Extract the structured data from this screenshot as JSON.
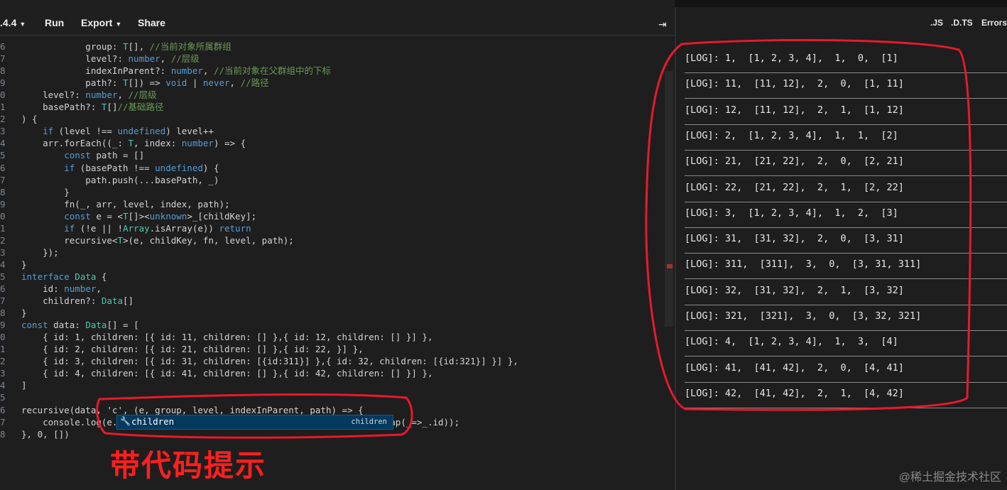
{
  "toolbar": {
    "version": ".4.4",
    "run": "Run",
    "export": "Export",
    "share": "Share",
    "collapse_icon": "collapse-right-icon"
  },
  "output_tabs": {
    "js": ".JS",
    "dts": ".D.TS",
    "errors": "Errors"
  },
  "editor": {
    "lines": [
      {
        "n": "6",
        "segs": [
          [
            "pl",
            "            group: "
          ],
          [
            "ty",
            "T"
          ],
          [
            "pl",
            "[], "
          ],
          [
            "cm",
            "//当前对象所属群组"
          ]
        ]
      },
      {
        "n": "7",
        "segs": [
          [
            "pl",
            "            level?: "
          ],
          [
            "kw",
            "number"
          ],
          [
            "pl",
            ", "
          ],
          [
            "cm",
            "//层级"
          ]
        ]
      },
      {
        "n": "8",
        "segs": [
          [
            "pl",
            "            indexInParent?: "
          ],
          [
            "kw",
            "number"
          ],
          [
            "pl",
            ", "
          ],
          [
            "cm",
            "//当前对象在父群组中的下标"
          ]
        ]
      },
      {
        "n": "9",
        "segs": [
          [
            "pl",
            "            path?: "
          ],
          [
            "ty",
            "T"
          ],
          [
            "pl",
            "[]) => "
          ],
          [
            "kw",
            "void"
          ],
          [
            "pl",
            " | "
          ],
          [
            "kw",
            "never"
          ],
          [
            "pl",
            ", "
          ],
          [
            "cm",
            "//路径"
          ]
        ]
      },
      {
        "n": "0",
        "segs": [
          [
            "pl",
            "    level?: "
          ],
          [
            "kw",
            "number"
          ],
          [
            "pl",
            ", "
          ],
          [
            "cm",
            "//层级"
          ]
        ]
      },
      {
        "n": "1",
        "segs": [
          [
            "pl",
            "    basePath?: "
          ],
          [
            "ty",
            "T"
          ],
          [
            "pl",
            "[]"
          ],
          [
            "cm",
            "//基础路径"
          ]
        ]
      },
      {
        "n": "2",
        "segs": [
          [
            "pl",
            ") {"
          ]
        ]
      },
      {
        "n": "3",
        "segs": [
          [
            "kw",
            "    if"
          ],
          [
            "pl",
            " (level !== "
          ],
          [
            "kw",
            "undefined"
          ],
          [
            "pl",
            ") level++"
          ]
        ]
      },
      {
        "n": "4",
        "segs": [
          [
            "pl",
            "    arr.forEach((_: "
          ],
          [
            "ty",
            "T"
          ],
          [
            "pl",
            ", index: "
          ],
          [
            "kw",
            "number"
          ],
          [
            "pl",
            ") => {"
          ]
        ]
      },
      {
        "n": "5",
        "segs": [
          [
            "kw",
            "        const"
          ],
          [
            "pl",
            " path = []"
          ]
        ]
      },
      {
        "n": "6",
        "segs": [
          [
            "kw",
            "        if"
          ],
          [
            "pl",
            " (basePath !== "
          ],
          [
            "kw",
            "undefined"
          ],
          [
            "pl",
            ") {"
          ]
        ]
      },
      {
        "n": "7",
        "segs": [
          [
            "pl",
            "            path.push(...basePath, _)"
          ]
        ]
      },
      {
        "n": "8",
        "segs": [
          [
            "pl",
            "        }"
          ]
        ]
      },
      {
        "n": "9",
        "segs": [
          [
            "pl",
            "        fn(_, arr, level, index, path);"
          ]
        ]
      },
      {
        "n": "0",
        "segs": [
          [
            "kw",
            "        const"
          ],
          [
            "pl",
            " e = <"
          ],
          [
            "ty",
            "T"
          ],
          [
            "pl",
            "[]><"
          ],
          [
            "kw",
            "unknown"
          ],
          [
            "pl",
            ">_[childKey];"
          ]
        ]
      },
      {
        "n": "1",
        "segs": [
          [
            "kw",
            "        if"
          ],
          [
            "pl",
            " (!e || !"
          ],
          [
            "ty",
            "Array"
          ],
          [
            "pl",
            ".isArray(e)) "
          ],
          [
            "kw",
            "return"
          ]
        ]
      },
      {
        "n": "2",
        "segs": [
          [
            "pl",
            "        recursive<"
          ],
          [
            "ty",
            "T"
          ],
          [
            "pl",
            ">(e, childKey, fn, level, path);"
          ]
        ]
      },
      {
        "n": "3",
        "segs": [
          [
            "pl",
            "    });"
          ]
        ]
      },
      {
        "n": "4",
        "segs": [
          [
            "pl",
            "}"
          ]
        ]
      },
      {
        "n": "5",
        "segs": [
          [
            "kw",
            "interface"
          ],
          [
            "pl",
            " "
          ],
          [
            "ty",
            "Data"
          ],
          [
            "pl",
            " {"
          ]
        ]
      },
      {
        "n": "6",
        "segs": [
          [
            "pl",
            "    id: "
          ],
          [
            "kw",
            "number"
          ],
          [
            "pl",
            ","
          ]
        ]
      },
      {
        "n": "7",
        "segs": [
          [
            "pl",
            "    children?: "
          ],
          [
            "ty",
            "Data"
          ],
          [
            "pl",
            "[]"
          ]
        ]
      },
      {
        "n": "8",
        "segs": [
          [
            "pl",
            "}"
          ]
        ]
      },
      {
        "n": "9",
        "segs": [
          [
            "kw",
            "const"
          ],
          [
            "pl",
            " data: "
          ],
          [
            "ty",
            "Data"
          ],
          [
            "pl",
            "[] = ["
          ]
        ]
      },
      {
        "n": "0",
        "segs": [
          [
            "pl",
            "    { id: 1, children: [{ id: 11, children: [] },{ id: 12, children: [] }] },"
          ]
        ]
      },
      {
        "n": "1",
        "segs": [
          [
            "pl",
            "    { id: 2, children: [{ id: 21, children: [] },{ id: 22, }] },"
          ]
        ]
      },
      {
        "n": "2",
        "segs": [
          [
            "pl",
            "    { id: 3, children: [{ id: 31, children: [{id:311}] },{ id: 32, children: [{id:321}] }] },"
          ]
        ]
      },
      {
        "n": "3",
        "segs": [
          [
            "pl",
            "    { id: 4, children: [{ id: 41, children: [] },{ id: 42, children: [] }] },"
          ]
        ]
      },
      {
        "n": "4",
        "segs": [
          [
            "pl",
            "]"
          ]
        ]
      },
      {
        "n": "5",
        "segs": [
          [
            "pl",
            ""
          ]
        ]
      },
      {
        "n": "6",
        "segs": [
          [
            "pl",
            "recursive(data, 'c', (e, group, level, indexInParent, path) => {"
          ]
        ]
      },
      {
        "n": "7",
        "segs": [
          [
            "pl",
            "    console.log(e.                                                  map(_=>_.id));"
          ]
        ]
      },
      {
        "n": "8",
        "segs": [
          [
            "pl",
            "}, 0, [])"
          ]
        ]
      }
    ]
  },
  "autocomplete": {
    "icon": "wrench-icon",
    "label": "children",
    "type_hint": "children"
  },
  "log_rows": [
    "[LOG]: 1,  [1, 2, 3, 4],  1,  0,  [1]",
    "[LOG]: 11,  [11, 12],  2,  0,  [1, 11]",
    "[LOG]: 12,  [11, 12],  2,  1,  [1, 12]",
    "[LOG]: 2,  [1, 2, 3, 4],  1,  1,  [2]",
    "[LOG]: 21,  [21, 22],  2,  0,  [2, 21]",
    "[LOG]: 22,  [21, 22],  2,  1,  [2, 22]",
    "[LOG]: 3,  [1, 2, 3, 4],  1,  2,  [3]",
    "[LOG]: 31,  [31, 32],  2,  0,  [3, 31]",
    "[LOG]: 311,  [311],  3,  0,  [3, 31, 311]",
    "[LOG]: 32,  [31, 32],  2,  1,  [3, 32]",
    "[LOG]: 321,  [321],  3,  0,  [3, 32, 321]",
    "[LOG]: 4,  [1, 2, 3, 4],  1,  3,  [4]",
    "[LOG]: 41,  [41, 42],  2,  0,  [4, 41]",
    "[LOG]: 42,  [41, 42],  2,  1,  [4, 42]"
  ],
  "annotation": {
    "caption": "带代码提示",
    "color": "#ff1f1f"
  },
  "watermark": "@稀土掘金技术社区"
}
